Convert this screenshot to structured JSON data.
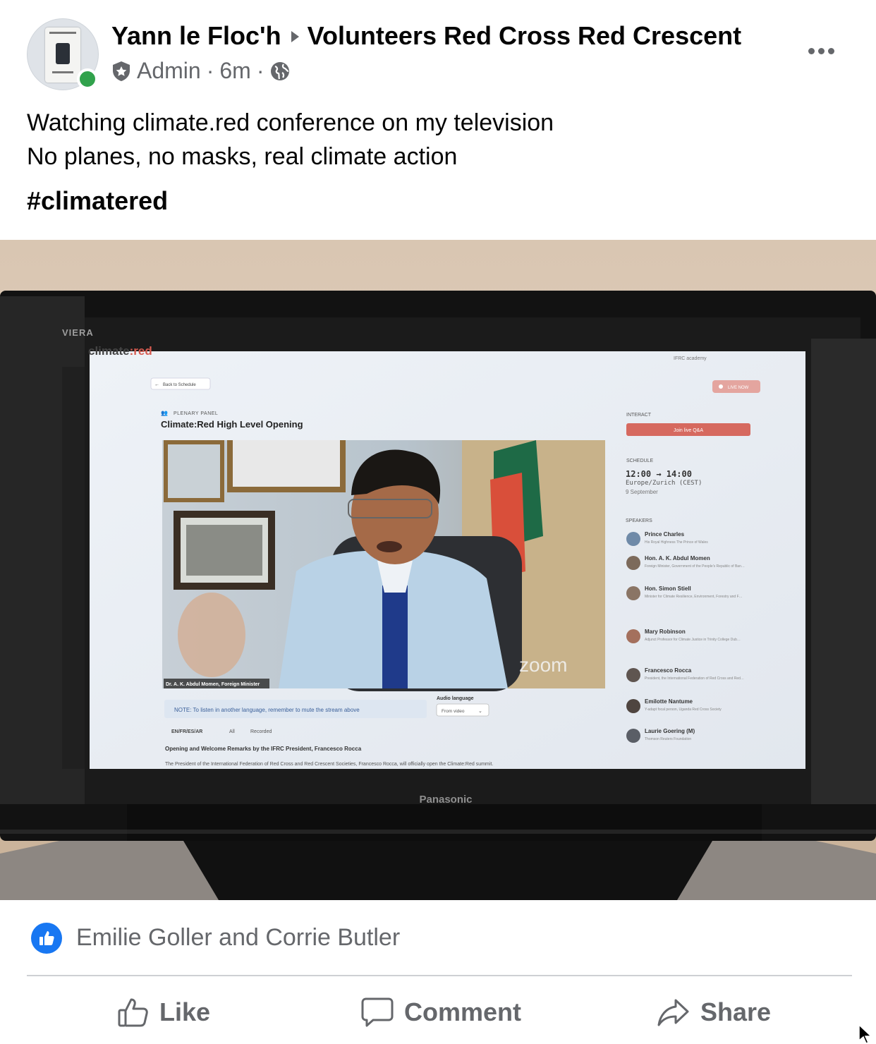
{
  "post": {
    "author": "Yann le Floc'h",
    "group": "Volunteers Red Cross Red Crescent",
    "role": "Admin",
    "separator": "·",
    "time": "6m",
    "text_line1": "Watching climate.red conference on my television",
    "text_line2": "No planes, no masks, real climate action",
    "hashtag": "#climatered"
  },
  "icons": {
    "more": "more-options-icon",
    "admin": "shield-icon",
    "privacy": "globe-icon",
    "like_reaction": "thumbs-up-icon"
  },
  "photo": {
    "tv_brand_top": "VIERA",
    "tv_brand_bottom": "Panasonic",
    "site_logo_a": "climate",
    "site_logo_b": ":red",
    "nav_links": "IFRC    academy",
    "back_label": "Back to Schedule",
    "live_label": "LIVE NOW",
    "session_type": "PLENARY PANEL",
    "session_title": "Climate:Red High Level Opening",
    "interact_label": "INTERACT",
    "join_label": "Join live Q&A",
    "schedule_label": "SCHEDULE",
    "schedule_time": "12:00 → 14:00",
    "schedule_tz": "Europe/Zurich (CEST)",
    "schedule_date": "9 September",
    "speakers_label": "SPEAKERS",
    "speakers": [
      {
        "name": "Prince Charles",
        "desc": "His Royal Highness The Prince of Wales"
      },
      {
        "name": "Hon. A. K. Abdul Momen",
        "desc": "Foreign Minister, Government of the People's Republic of Bangladesh"
      },
      {
        "name": "Hon. Simon Stiell",
        "desc": "Minister for Climate Resilience, Environment, Forestry and Fisheries, Disaster Management, Government of Grenada"
      },
      {
        "name": "Mary Robinson",
        "desc": "Adjunct Professor for Climate Justice in Trinity College Dublin and Chair of The Elders"
      },
      {
        "name": "Francesco Rocca",
        "desc": "President, the International Federation of Red Cross and Red Crescent Societies"
      },
      {
        "name": "Emilotte Nantume",
        "desc": "Y-adapt focal person, Uganda Red Cross Society"
      },
      {
        "name": "Laurie Goering (M)",
        "desc": "Thomson Reuters Foundation"
      }
    ],
    "video_caption": "Dr. A. K. Abdul Momen, Foreign Minister",
    "zoom_label": "zoom",
    "note_text": "NOTE: To listen in another language, remember to mute the stream above",
    "audio_label": "Audio language",
    "audio_value": "From video",
    "lang_tags": "EN/FR/ES/AR",
    "all_tag": "All",
    "recorded_tag": "Recorded",
    "desc_title": "Opening and Welcome Remarks by the IFRC President, Francesco Rocca",
    "desc_body": "The President of the International Federation of Red Cross and Red Crescent Societies, Francesco Rocca, will officially open the Climate:Red summit."
  },
  "reactions": {
    "names": "Emilie Goller and Corrie Butler"
  },
  "actions": {
    "like": "Like",
    "comment": "Comment",
    "share": "Share"
  },
  "colors": {
    "facebook_blue": "#1877f2",
    "online_green": "#31a24c",
    "secondary_text": "#65676b",
    "climate_red": "#d65a4f"
  }
}
